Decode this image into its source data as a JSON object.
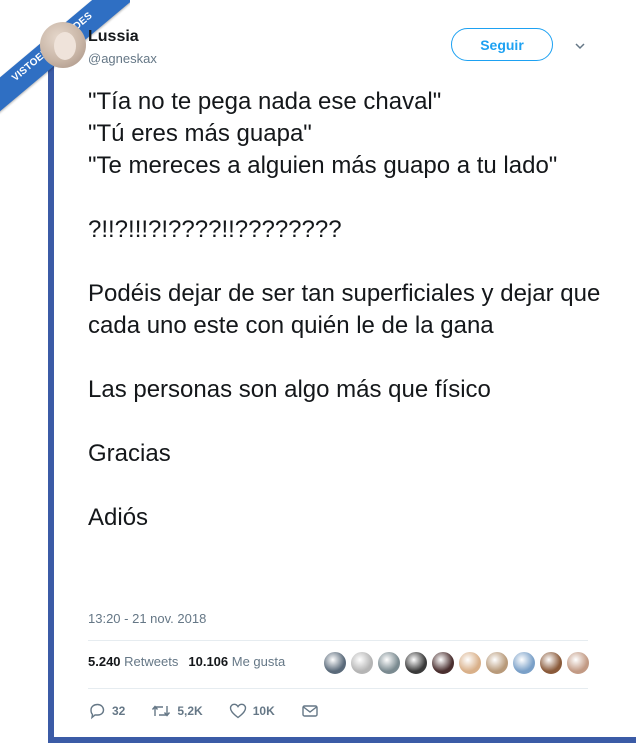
{
  "watermark": {
    "text": "VISTOENLASREDES",
    "sub": ".com"
  },
  "user": {
    "name": "Lussia",
    "handle": "@agneskax"
  },
  "follow_button": {
    "label": "Seguir"
  },
  "tweet": {
    "lines": [
      "\"Tía no te pega nada ese chaval\"",
      "\"Tú eres más guapa\"",
      "\"Te mereces a alguien más guapo a tu lado\"",
      "",
      "?!!?!!!?!????!!????????",
      "",
      "Podéis dejar de ser tan superficiales y dejar que cada uno este con quién le de la gana",
      "",
      "Las personas son algo más que físico",
      "",
      "Gracias",
      "",
      "Adiós"
    ]
  },
  "timestamp": "13:20 - 21 nov. 2018",
  "stats": {
    "retweets_count": "5.240",
    "retweets_label": "Retweets",
    "likes_count": "10.106",
    "likes_label": "Me gusta"
  },
  "liker_avatar_colors": [
    "#5a6a7a",
    "#b5b5b5",
    "#7a8a90",
    "#3a3a3a",
    "#4a2f2f",
    "#d9b089",
    "#b89a7a",
    "#7aa0c8",
    "#8a5a3a",
    "#c29a84"
  ],
  "actions": {
    "replies": "32",
    "retweets": "5,2K",
    "likes": "10K"
  },
  "colors": {
    "accent": "#1da1f2",
    "frame": "#3b5ba6",
    "muted": "#657786"
  }
}
